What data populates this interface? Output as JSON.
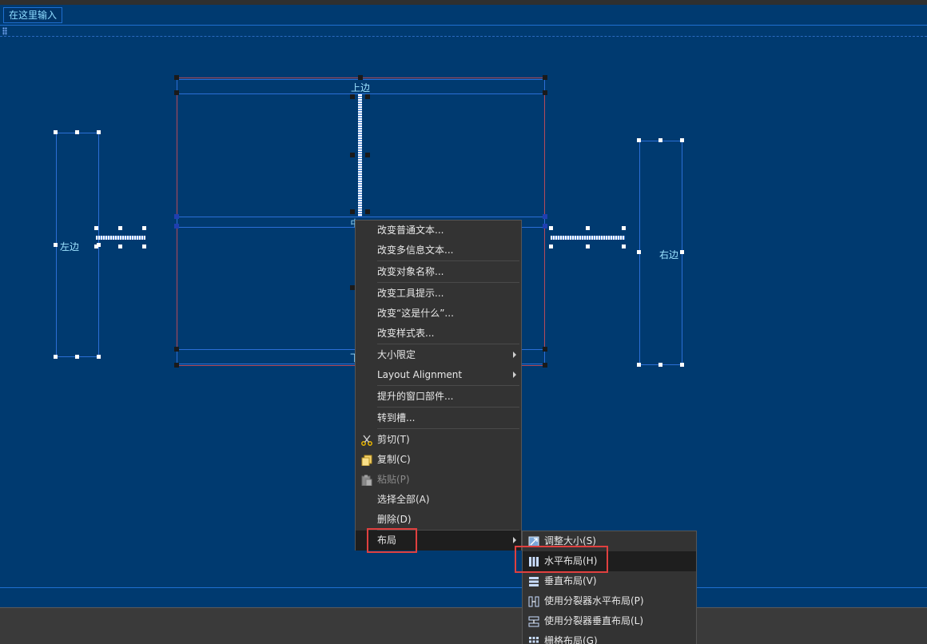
{
  "menubar": {
    "type_here": "在这里输入"
  },
  "canvas": {
    "label_top": "上边",
    "label_left": "左边",
    "label_right": "右边",
    "label_center": "中",
    "label_bottom": "下"
  },
  "context_menu": {
    "items": [
      {
        "label": "改变普通文本..."
      },
      {
        "label": "改变多信息文本..."
      },
      {
        "label": "改变对象名称..."
      },
      {
        "label": "改变工具提示..."
      },
      {
        "label": "改变“这是什么”..."
      },
      {
        "label": "改变样式表..."
      },
      {
        "label": "大小限定"
      },
      {
        "label": "Layout Alignment"
      },
      {
        "label": "提升的窗口部件..."
      },
      {
        "label": "转到槽..."
      },
      {
        "label": "剪切(T)",
        "icon": "scissors-icon"
      },
      {
        "label": "复制(C)",
        "icon": "copy-icon"
      },
      {
        "label": "粘贴(P)",
        "icon": "paste-icon",
        "disabled": true
      },
      {
        "label": "选择全部(A)"
      },
      {
        "label": "删除(D)"
      },
      {
        "label": "布局"
      }
    ]
  },
  "layout_submenu": {
    "items": [
      {
        "label": "调整大小(S)",
        "icon": "adjust-size-icon"
      },
      {
        "label": "水平布局(H)",
        "icon": "horizontal-layout-icon"
      },
      {
        "label": "垂直布局(V)",
        "icon": "vertical-layout-icon"
      },
      {
        "label": "使用分裂器水平布局(P)",
        "icon": "splitter-horizontal-icon"
      },
      {
        "label": "使用分裂器垂直布局(L)",
        "icon": "splitter-vertical-icon"
      },
      {
        "label": "栅格布局(G)",
        "icon": "grid-layout-icon"
      }
    ]
  },
  "colors": {
    "canvas_bg": "#003a70",
    "menu_bg": "#333333",
    "highlight_red": "#e0403f",
    "label_cyan": "#9fe3ff"
  }
}
